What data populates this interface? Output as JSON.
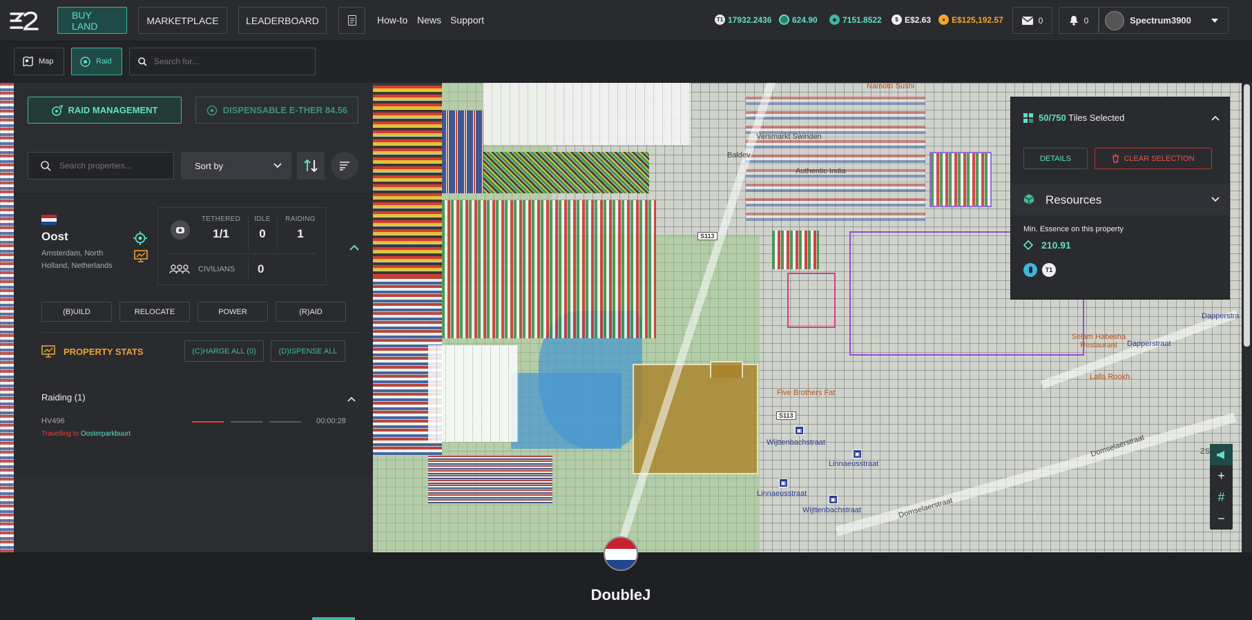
{
  "nav": {
    "buy_land": "BUY LAND",
    "marketplace": "MARKETPLACE",
    "leaderboard": "LEADERBOARD",
    "how_to": "How-to",
    "news": "News",
    "support": "Support"
  },
  "balances": {
    "t1": "17932.2436",
    "essence": "624.90",
    "ether": "7151.8522",
    "dollar": "E$2.63",
    "gold": "E$125,192.57"
  },
  "notifications": {
    "mail_count": "0",
    "bell_count": "0"
  },
  "user": {
    "name": "Spectrum3900"
  },
  "subbar": {
    "map_label": "Map",
    "raid_label": "Raid",
    "search_placeholder": "Search for..."
  },
  "left_panel": {
    "raid_management": "RAID MANAGEMENT",
    "dispensable": "DISPENSABLE E-THER 84.56",
    "search_placeholder": "Search properties...",
    "sort_by": "Sort by",
    "property": {
      "name": "Oost",
      "location": "Amsterdam, North Holland, Netherlands",
      "tethered_label": "TETHERED",
      "tethered_value": "1/1",
      "idle_label": "IDLE",
      "idle_value": "0",
      "raiding_label": "RAIDING",
      "raiding_value": "1",
      "civilians_label": "CIVILIANS",
      "civilians_value": "0"
    },
    "actions": [
      "(B)UILD",
      "RELOCATE",
      "POWER",
      "(R)AID"
    ],
    "property_stats": "PROPERTY STATS",
    "charge_all": "(C)HARGE ALL (0)",
    "dispense_all": "(D)ISPENSE ALL",
    "raiding_header": "Raiding (1)",
    "raid_item": {
      "id": "HV496",
      "status_prefix": "Travelling to",
      "destination": "Oosterparkbuurt",
      "timer": "00:00:28"
    }
  },
  "right_panel": {
    "tiles_selected": "50/750",
    "tiles_label": "Tiles Selected",
    "details": "DETAILS",
    "clear_selection": "CLEAR SELECTION",
    "resources": "Resources",
    "min_essence_label": "Min. Essence on this property",
    "min_essence_value": "210.91",
    "tier_badge": "T1"
  },
  "map_labels": {
    "namoto": "Namoto Sushi",
    "versmarkt": "Versmarkt Swinden",
    "baldev": "Baldev",
    "authentic": "Authentic India",
    "s113a": "S113",
    "s113b": "S113",
    "five_brothers": "Five Brothers Fat",
    "wijttenbach1": "Wijttenbachstraat",
    "linnaeus1": "Linnaeusstraat",
    "linnaeus2": "Linnaeusstraat",
    "wijttenbach2": "Wijttenbachstraat",
    "domselaer1": "Domselaerstraat",
    "domselaer2": "Domselaerstraat",
    "dapper1": "Dapperstraat",
    "dapper2": "Dapperstra",
    "selam": "Selam Habesha Restaurant",
    "lalla": "Lalla Rookh",
    "zs": "ZS"
  },
  "bottom": {
    "owner_name": "DoubleJ"
  },
  "colors": {
    "accent": "#3fb8a2",
    "danger": "#e0453c",
    "stats_orange": "#e8a33a"
  }
}
